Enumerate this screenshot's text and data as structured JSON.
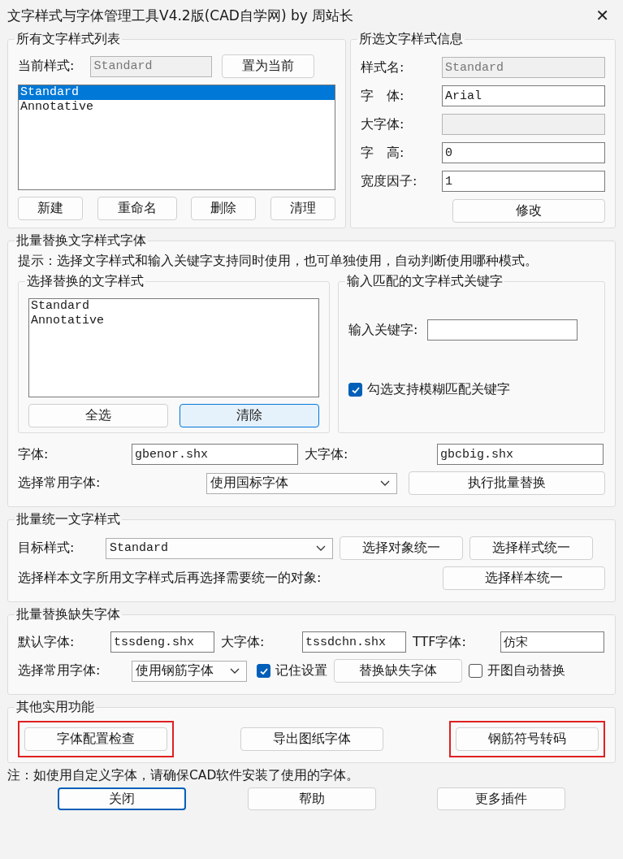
{
  "window": {
    "title": "文字样式与字体管理工具V4.2版(CAD自学网) by 周站长",
    "close": "✕"
  },
  "style_list": {
    "title": "所有文字样式列表",
    "current_label": "当前样式:",
    "current_value": "Standard",
    "set_current": "置为当前",
    "items": [
      {
        "label": "Standard",
        "selected": true
      },
      {
        "label": "Annotative",
        "selected": false
      }
    ],
    "buttons": [
      "新建",
      "重命名",
      "删除",
      "清理"
    ]
  },
  "style_info": {
    "title": "所选文字样式信息",
    "fields": [
      {
        "label": "样式名:",
        "value": "Standard",
        "disabled": true
      },
      {
        "label": "字　体:",
        "value": "Arial",
        "disabled": false
      },
      {
        "label": "大字体:",
        "disabled": true
      },
      {
        "label": "字　高:",
        "value": "0",
        "disabled": false
      },
      {
        "label": "宽度因子:",
        "value": "1",
        "disabled": false
      }
    ],
    "button": "修改"
  },
  "batch_replace": {
    "title": "批量替换文字样式字体",
    "hint": "提示：选择文字样式和输入关键字支持同时使用，也可单独使用，自动判断使用哪种模式。",
    "select_group": {
      "title": "选择替换的文字样式",
      "items": [
        {
          "label": "Standard",
          "selected": false
        },
        {
          "label": "Annotative",
          "selected": false
        }
      ],
      "buttons": [
        {
          "label": "全选",
          "hover": false
        },
        {
          "label": "清除",
          "hover": true
        }
      ]
    },
    "keyword_group": {
      "title": "输入匹配的文字样式关键字",
      "label": "输入关键字:",
      "fuzzy": {
        "label": "勾选支持模糊匹配关键字",
        "checked": true
      }
    },
    "font_label": "字体:",
    "font_value": "gbenor.shx",
    "bigfont_label": "大字体:",
    "bigfont_value": "gbcbig.shx",
    "common_label": "选择常用字体:",
    "common_value": "使用国标字体",
    "run_button": "执行批量替换"
  },
  "unify": {
    "title": "批量统一文字样式",
    "target_label": "目标样式:",
    "target_value": "Standard",
    "buttons": [
      "选择对象统一",
      "选择样式统一"
    ],
    "sample_text": "选择样本文字所用文字样式后再选择需要统一的对象:",
    "sample_button": "选择样本统一"
  },
  "missing": {
    "title": "批量替换缺失字体",
    "default_label": "默认字体:",
    "default_value": "tssdeng.shx",
    "bigfont_label": "大字体:",
    "bigfont_value": "tssdchn.shx",
    "ttf_label": "TTF字体:",
    "ttf_value": "仿宋",
    "common_label": "选择常用字体:",
    "common_value": "使用钢筋字体",
    "remember": {
      "label": "记住设置",
      "checked": true
    },
    "replace_button": "替换缺失字体",
    "auto": {
      "label": "开图自动替换",
      "checked": false
    }
  },
  "tools": {
    "title": "其他实用功能",
    "buttons": [
      {
        "label": "字体配置检查",
        "outlined": true
      },
      {
        "label": "导出图纸字体",
        "outlined": false
      },
      {
        "label": "钢筋符号转码",
        "outlined": true
      }
    ]
  },
  "note": "注：如使用自定义字体，请确保CAD软件安装了使用的字体。",
  "footer": [
    {
      "label": "关闭",
      "default": true
    },
    {
      "label": "帮助",
      "default": false
    },
    {
      "label": "更多插件",
      "default": false
    }
  ]
}
